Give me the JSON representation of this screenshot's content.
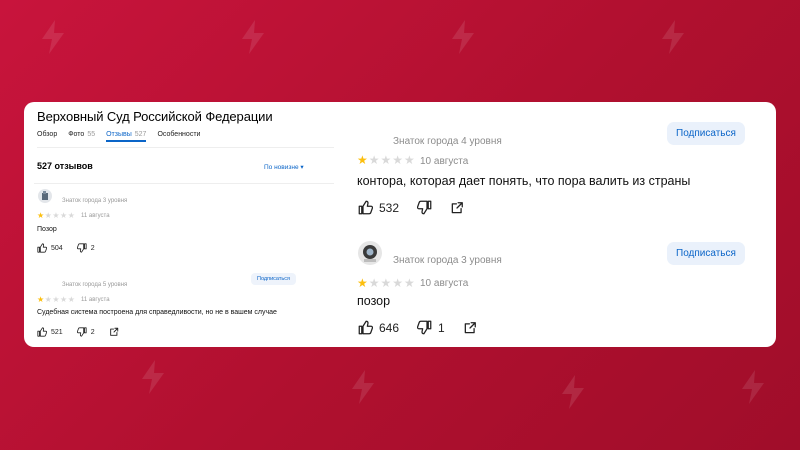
{
  "org": {
    "title": "Верховный Суд Российской Федерации",
    "tabs": [
      {
        "label": "Обзор",
        "count": ""
      },
      {
        "label": "Фото",
        "count": "55"
      },
      {
        "label": "Отзывы",
        "count": "527"
      },
      {
        "label": "Особенности",
        "count": ""
      }
    ],
    "active_tab": "Отзывы",
    "reviews_count": "527 отзывов",
    "sort_label": "По новизне ▾"
  },
  "left_reviews": [
    {
      "level": "Знаток города 3 уровня",
      "rating": 1,
      "date": "11 августа",
      "text": "Позор",
      "likes": "504",
      "dislikes": "2",
      "subscribe": ""
    },
    {
      "level": "Знаток города 5 уровня",
      "rating": 1,
      "date": "11 августа",
      "text": "Судебная система построена для справедливости, но не в вашем случае",
      "likes": "521",
      "dislikes": "2",
      "subscribe": "Подписаться"
    }
  ],
  "right_reviews": [
    {
      "level": "Знаток города 4 уровня",
      "rating": 1,
      "date": "10 августа",
      "text": "контора, которая дает понять, что пора валить из страны",
      "likes": "532",
      "dislikes": "",
      "subscribe": "Подписаться"
    },
    {
      "level": "Знаток города 3 уровня",
      "rating": 1,
      "date": "10 августа",
      "text": "позор",
      "likes": "646",
      "dislikes": "1",
      "subscribe": "Подписаться"
    }
  ],
  "colors": {
    "background": "#c8143c",
    "accent": "#0b65c8",
    "star_active": "#fcbf0f",
    "star_inactive": "#d9d9d9"
  },
  "icons": [
    "thumb-up-icon",
    "thumb-down-icon",
    "share-icon",
    "star-icon",
    "lightning-icon",
    "chevron-down-icon"
  ]
}
